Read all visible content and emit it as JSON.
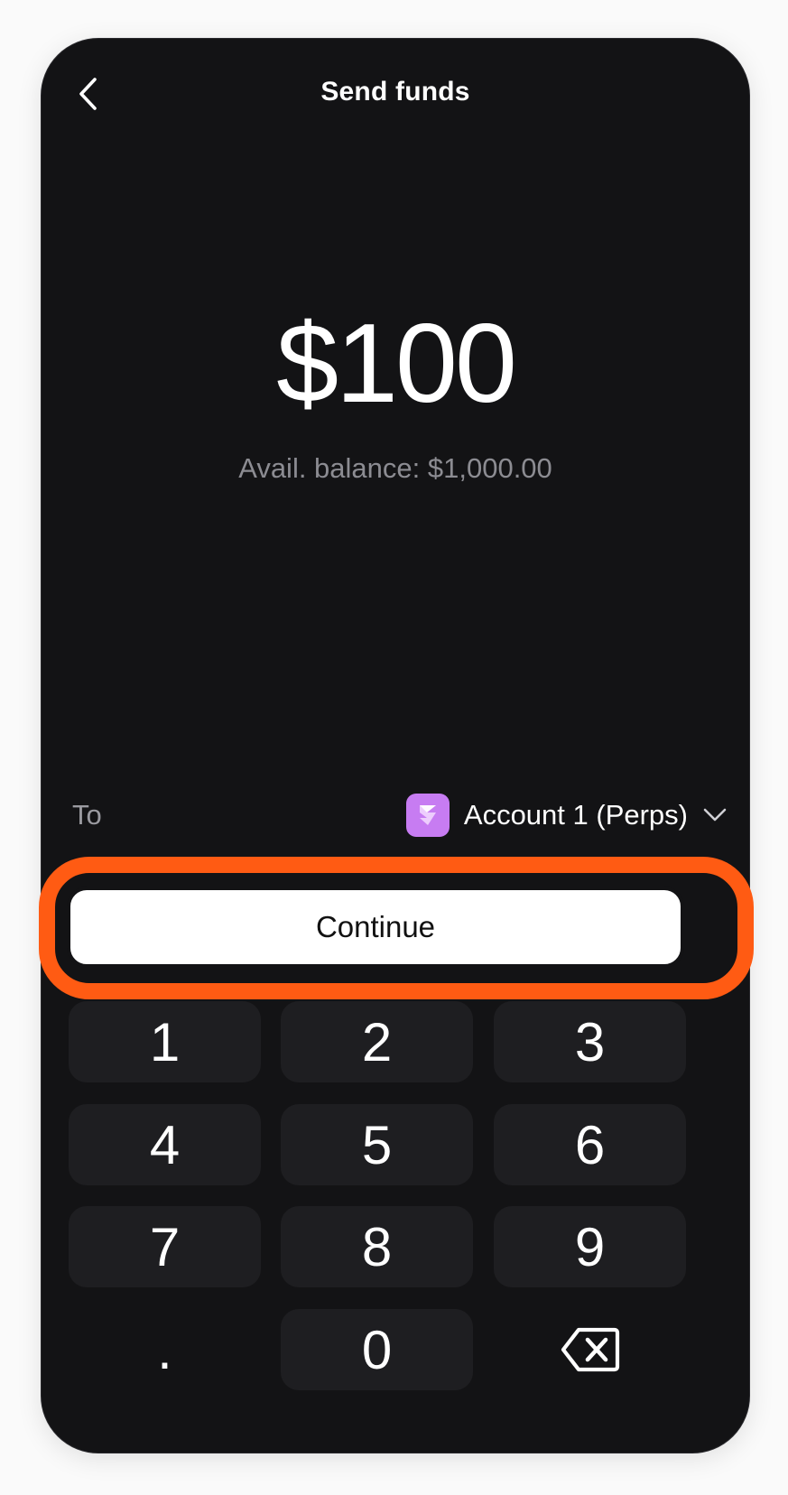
{
  "header": {
    "title": "Send funds",
    "back_icon": "chevron-left-icon"
  },
  "amount": {
    "value": "$100",
    "balance_text": "Avail. balance: $1,000.00"
  },
  "recipient": {
    "label": "To",
    "account_name": "Account 1 (Perps)",
    "account_icon": "account-badge-icon",
    "dropdown_icon": "chevron-down-icon",
    "account_color": "#c77cf2"
  },
  "continue_label": "Continue",
  "keypad": {
    "keys": [
      "1",
      "2",
      "3",
      "4",
      "5",
      "6",
      "7",
      "8",
      "9",
      ".",
      "0"
    ],
    "delete_icon": "backspace-icon"
  },
  "colors": {
    "background": "#131315",
    "key_background": "#1e1e21",
    "highlight": "#ff5b13"
  }
}
